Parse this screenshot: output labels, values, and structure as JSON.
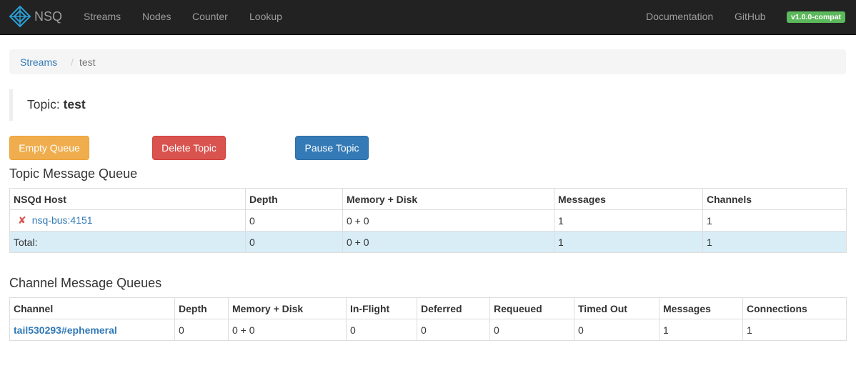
{
  "navbar": {
    "brand": "NSQ",
    "items": [
      "Streams",
      "Nodes",
      "Counter",
      "Lookup"
    ],
    "right_items": [
      "Documentation",
      "GitHub"
    ],
    "version": "v1.0.0-compat"
  },
  "breadcrumb": {
    "link": "Streams",
    "separator": "/",
    "active": "test"
  },
  "topic": {
    "prefix": "Topic:",
    "name": "test"
  },
  "actions": {
    "empty_queue": "Empty Queue",
    "delete_topic": "Delete Topic",
    "pause_topic": "Pause Topic"
  },
  "topic_queue": {
    "heading": "Topic Message Queue",
    "headers": [
      "NSQd Host",
      "Depth",
      "Memory + Disk",
      "Messages",
      "Channels"
    ],
    "rows": [
      {
        "icon": "✘",
        "host": "nsq-bus:4151",
        "depth": "0",
        "mem": "0 + 0",
        "messages": "1",
        "channels": "1"
      }
    ],
    "total": {
      "label": "Total:",
      "depth": "0",
      "mem": "0 + 0",
      "messages": "1",
      "channels": "1"
    }
  },
  "channel_queues": {
    "heading": "Channel Message Queues",
    "headers": [
      "Channel",
      "Depth",
      "Memory + Disk",
      "In-Flight",
      "Deferred",
      "Requeued",
      "Timed Out",
      "Messages",
      "Connections"
    ],
    "rows": [
      {
        "channel": "tail530293#ephemeral",
        "depth": "0",
        "mem": "0 + 0",
        "inflight": "0",
        "deferred": "0",
        "requeued": "0",
        "timedout": "0",
        "messages": "1",
        "connections": "1"
      }
    ]
  },
  "colors": {
    "navbar": "#222222",
    "link": "#337ab7",
    "warning": "#f0ad4e",
    "danger": "#d9534f",
    "primary": "#337ab7",
    "success": "#5cb85c",
    "info_row": "#d9edf7"
  }
}
